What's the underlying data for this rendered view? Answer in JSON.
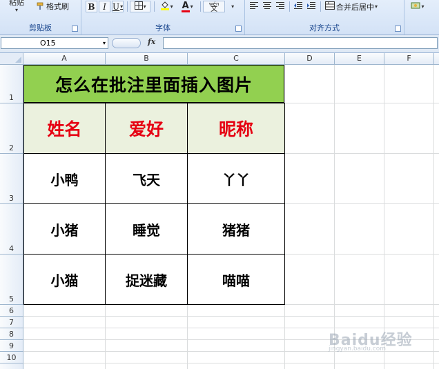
{
  "ribbon": {
    "clipboard": {
      "paste_label": "粘贴",
      "format_painter_label": "格式刷",
      "group_label": "剪贴板"
    },
    "font": {
      "bold": "B",
      "italic": "I",
      "underline": "U",
      "font_color_letter": "A",
      "phonetic_label": "wén",
      "phonetic_char": "文",
      "group_label": "字体"
    },
    "alignment": {
      "merge_center_label": "合并后居中",
      "group_label": "对齐方式"
    }
  },
  "formula_bar": {
    "name_box": "O15",
    "fx_label": "fx",
    "formula": ""
  },
  "columns": [
    "A",
    "B",
    "C",
    "D",
    "E",
    "F"
  ],
  "rows": [
    "1",
    "2",
    "3",
    "4",
    "5",
    "6",
    "7",
    "8",
    "9",
    "10"
  ],
  "sheet": {
    "title": "怎么在批注里面插入图片",
    "headers": [
      "姓名",
      "爱好",
      "昵称"
    ],
    "data": [
      [
        "小鸭",
        "飞天",
        "丫丫"
      ],
      [
        "小猪",
        "睡觉",
        "猪猪"
      ],
      [
        "小猫",
        "捉迷藏",
        "喵喵"
      ]
    ]
  },
  "colors": {
    "title_fill": "#92d050",
    "header_fill": "#ebf1de",
    "header_text": "#e60012"
  },
  "watermark": {
    "brand": "Baidu经验",
    "url": "jingyan.baidu.com"
  }
}
